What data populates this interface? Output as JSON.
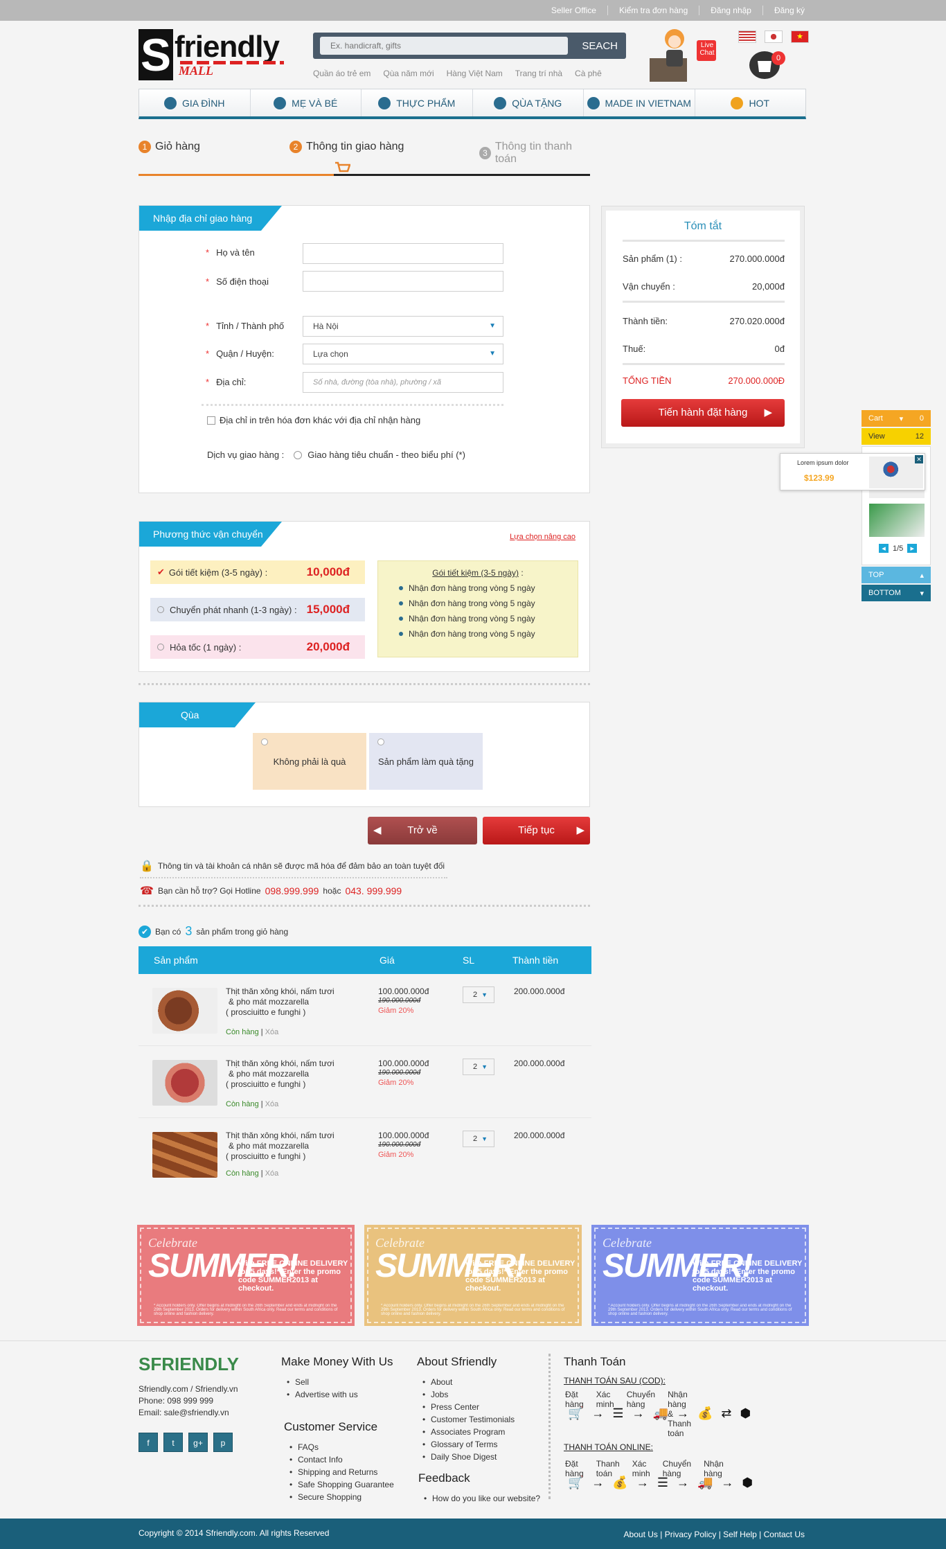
{
  "topbar": {
    "links": [
      "Seller Office",
      "Kiểm tra đơn hàng",
      "Đăng nhập",
      "Đăng ký"
    ]
  },
  "logo": {
    "letter": "S",
    "word": "friendly",
    "sub": "MALL"
  },
  "search": {
    "placeholder": "Ex. handicraft, gifts",
    "button": "SEACH",
    "links": [
      "Quần áo trẻ em",
      "Qùa năm mới",
      "Hàng Việt Nam",
      "Trang trí nhà",
      "Cà phê"
    ]
  },
  "livechat": "Live Chat",
  "cart": {
    "count": "0"
  },
  "nav": [
    "GIA ĐÌNH",
    "MẸ VÀ BÉ",
    "THỰC PHẨM",
    "QÙA TẶNG",
    "MADE IN VIETNAM",
    "HOT"
  ],
  "steps": [
    {
      "num": "1",
      "label": "Giỏ hàng"
    },
    {
      "num": "2",
      "label": "Thông tin giao hàng"
    },
    {
      "num": "3",
      "label": "Thông tin thanh toán"
    }
  ],
  "address": {
    "title": "Nhập địa chỉ giao hàng",
    "name_label": "Họ và tên",
    "phone_label": "Số điện thoại",
    "city_label": "Tỉnh / Thành phố",
    "city_value": "Hà Nội",
    "district_label": "Quận / Huyện:",
    "district_value": "Lựa chọn",
    "addr_label": "Địa chỉ:",
    "addr_placeholder": "Số nhà, đường (tòa nhà), phường / xã",
    "invoice_check": "Địa chỉ in trên hóa đơn khác với địa chỉ nhận hàng",
    "service_label": "Dịch vụ giao hàng :",
    "service_value": "Giao hàng tiêu chuẩn - theo biểu phí (*)"
  },
  "summary": {
    "title": "Tóm tắt",
    "rows": [
      {
        "k": "Sản phẩm (1) :",
        "v": "270.000.000đ"
      },
      {
        "k": "Vận chuyển :",
        "v": "20,000đ"
      },
      {
        "k": "Thành tiền:",
        "v": "270.020.000đ"
      },
      {
        "k": "Thuế:",
        "v": "0đ"
      }
    ],
    "total_label": "TỔNG TIỀN",
    "total_value": "270.000.000Đ",
    "button": "Tiến hành đặt hàng"
  },
  "shipping": {
    "title": "Phương thức vận chuyển",
    "advanced": "Lựa chọn nâng cao",
    "options": [
      {
        "label": "Gói tiết kiệm (3-5 ngày) :",
        "price": "10,000đ"
      },
      {
        "label": "Chuyển phát nhanh (1-3 ngày) :",
        "price": "15,000đ"
      },
      {
        "label": "Hỏa tốc (1 ngày) :",
        "price": "20,000đ"
      }
    ],
    "detail_title": "Gói tiết kiệm (3-5 ngày)",
    "detail_suffix": ":",
    "details": [
      "Nhận đơn hàng trong vòng 5 ngày",
      "Nhận đơn hàng trong vòng 5 ngày",
      "Nhận đơn hàng trong vòng 5 ngày",
      "Nhận đơn hàng trong vòng 5 ngày"
    ]
  },
  "gift": {
    "title": "Qùa",
    "opt1": "Không phải là quà",
    "opt2": "Sản phẩm làm quà tặng"
  },
  "actions": {
    "back": "Trở về",
    "next": "Tiếp tục"
  },
  "secure": "Thông tin và tài khoản cá nhân sẽ được mã hóa để đảm bảo an toàn tuyệt đối",
  "hotline": {
    "prefix": "Bạn cần hỗ trợ? Gọi Hotline",
    "n1": "098.999.999",
    "mid": "hoặc",
    "n2": "043. 999.999"
  },
  "cartinfo": {
    "prefix": "Bạn có",
    "count": "3",
    "suffix": "sản phẩm trong giỏ hàng"
  },
  "table": {
    "headers": [
      "Sản phẩm",
      "Giá",
      "SL",
      "Thành tiền"
    ],
    "rows": [
      {
        "name1": "Thịt thăn xông khói, nấm tươi",
        "name2": "& pho mát mozzarella",
        "name3": "( prosciuitto e funghi )",
        "stock": "Còn hàng",
        "del": "Xóa",
        "price": "100.000.000đ",
        "old": "190.000.000đ",
        "disc": "Giảm 20%",
        "qty": "2",
        "total": "200.000.000đ"
      },
      {
        "name1": "Thịt thăn xông khói, nấm tươi",
        "name2": "& pho mát mozzarella",
        "name3": "( prosciuitto e funghi )",
        "stock": "Còn hàng",
        "del": "Xóa",
        "price": "100.000.000đ",
        "old": "190.000.000đ",
        "disc": "Giảm 20%",
        "qty": "2",
        "total": "200.000.000đ"
      },
      {
        "name1": "Thịt thăn xông khói, nấm tươi",
        "name2": "& pho mát mozzarella",
        "name3": "( prosciuitto e funghi )",
        "stock": "Còn hàng",
        "del": "Xóa",
        "price": "100.000.000đ",
        "old": "190.000.000đ",
        "disc": "Giảm 20%",
        "qty": "2",
        "total": "200.000.000đ"
      }
    ]
  },
  "coupon": {
    "c1": "Celebrate",
    "c2": "SUMMER!",
    "c3": "With FREE ONLINE DELIVERY for 5 days!* Enter the promo code SUMMER2013 at checkout.",
    "c4": "* Account holders only. Offer begins at midnight on the 26th September and ends at midnight on the 29th September 2013. Orders for delivery within South Africa only. Read our terms and conditions of shop online and fashion delivery.",
    "colors": [
      "#e97b7e",
      "#e9c27e",
      "#7e8fe9"
    ]
  },
  "footer": {
    "brand": "SFRIENDLY",
    "site": "Sfriendly.com / Sfriendly.vn",
    "phone": "Phone: 098 999 999",
    "email": "Email: sale@sfriendly.vn",
    "social": [
      "f",
      "t",
      "g+",
      "p"
    ],
    "make": {
      "title": "Make Money With Us",
      "items": [
        "Sell",
        "Advertise with us"
      ]
    },
    "cs": {
      "title": "Customer Service",
      "items": [
        "FAQs",
        "Contact Info",
        "Shipping and Returns",
        "Safe Shopping Guarantee",
        "Secure Shopping"
      ]
    },
    "about": {
      "title": "About Sfriendly",
      "items": [
        "About",
        "Jobs",
        "Press Center",
        "Customer Testimonials",
        "Associates Program",
        "Glossary of Terms",
        "Daily Shoe Digest"
      ]
    },
    "feedback": {
      "title": "Feedback",
      "items": [
        "How do you like our website?"
      ]
    },
    "pay": {
      "title": "Thanh Toán",
      "cod": "THANH TOÁN SAU (COD):",
      "cod_steps": [
        "Đặt hàng",
        "Xác minh",
        "Chuyển hàng",
        "Nhận hàng & Thanh toán"
      ],
      "online": "THANH TOÁN ONLINE:",
      "online_steps": [
        "Đặt hàng",
        "Thanh toán",
        "Xác minh",
        "Chuyển hàng",
        "Nhận hàng"
      ]
    }
  },
  "bottom": {
    "copy": "Copyright © 2014 Sfriendly.com. All rights Reserved",
    "links": "About Us | Privacy Policy | Self Help | Contact Us"
  },
  "sidebar": {
    "cart": "Cart",
    "cart_n": "0",
    "view": "View",
    "view_n": "12",
    "popup_text": "Lorem ipsum dolor",
    "popup_price": "$123.99",
    "page": "1/5",
    "top": "TOP",
    "bottom": "BOTTOM"
  }
}
